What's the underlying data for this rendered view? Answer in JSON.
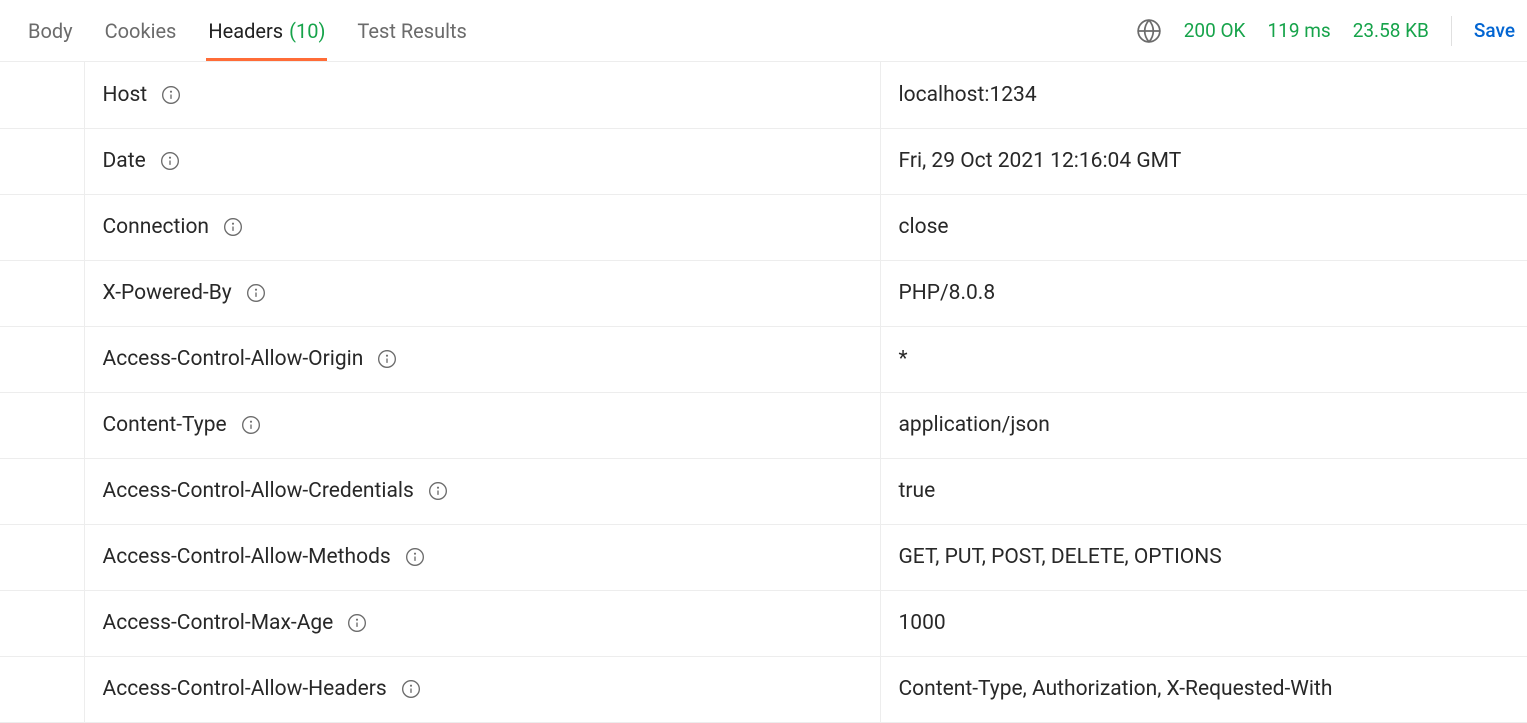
{
  "tabs": {
    "body": "Body",
    "cookies": "Cookies",
    "headers_label": "Headers",
    "headers_count": "(10)",
    "test_results": "Test Results"
  },
  "status": {
    "code": "200 OK",
    "time": "119 ms",
    "size": "23.58 KB",
    "save": "Save"
  },
  "headers": [
    {
      "name": "Host",
      "value": "localhost:1234"
    },
    {
      "name": "Date",
      "value": "Fri, 29 Oct 2021 12:16:04 GMT"
    },
    {
      "name": "Connection",
      "value": "close"
    },
    {
      "name": "X-Powered-By",
      "value": "PHP/8.0.8"
    },
    {
      "name": "Access-Control-Allow-Origin",
      "value": "*"
    },
    {
      "name": "Content-Type",
      "value": "application/json"
    },
    {
      "name": "Access-Control-Allow-Credentials",
      "value": "true"
    },
    {
      "name": "Access-Control-Allow-Methods",
      "value": "GET, PUT, POST, DELETE, OPTIONS"
    },
    {
      "name": "Access-Control-Max-Age",
      "value": "1000"
    },
    {
      "name": "Access-Control-Allow-Headers",
      "value": "Content-Type, Authorization, X-Requested-With"
    }
  ]
}
